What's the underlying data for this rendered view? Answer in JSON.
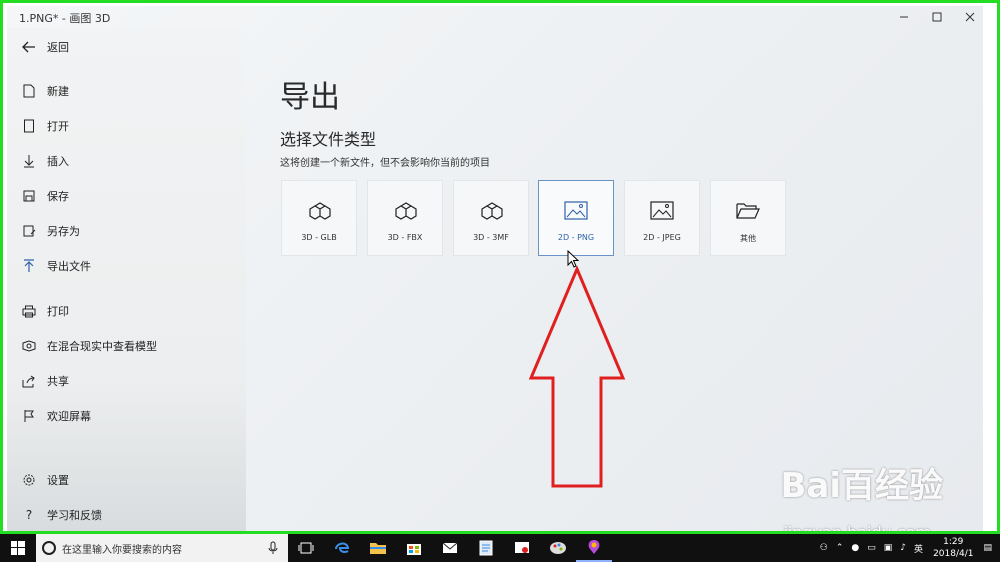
{
  "window": {
    "title": "1.PNG* - 画图 3D"
  },
  "sidebar": {
    "back_label": "返回",
    "items": [
      {
        "label": "新建",
        "icon": "new-file-icon"
      },
      {
        "label": "打开",
        "icon": "open-icon"
      },
      {
        "label": "插入",
        "icon": "insert-icon"
      },
      {
        "label": "保存",
        "icon": "save-icon"
      },
      {
        "label": "另存为",
        "icon": "save-as-icon"
      },
      {
        "label": "导出文件",
        "icon": "export-icon"
      },
      {
        "label": "打印",
        "icon": "print-icon"
      },
      {
        "label": "在混合现实中查看模型",
        "icon": "mixed-reality-icon"
      },
      {
        "label": "共享",
        "icon": "share-icon"
      },
      {
        "label": "欢迎屏幕",
        "icon": "flag-icon"
      }
    ],
    "bottom": [
      {
        "label": "设置",
        "icon": "gear-icon"
      },
      {
        "label": "学习和反馈",
        "icon": "help-icon"
      }
    ]
  },
  "main": {
    "heading": "导出",
    "subheading": "选择文件类型",
    "description": "这将创建一个新文件，但不会影响你当前的项目",
    "file_types": [
      {
        "label": "3D - GLB",
        "icon": "3d-shapes-icon"
      },
      {
        "label": "3D - FBX",
        "icon": "3d-shapes-icon"
      },
      {
        "label": "3D - 3MF",
        "icon": "3d-shapes-icon"
      },
      {
        "label": "2D - PNG",
        "icon": "image-icon",
        "selected": true
      },
      {
        "label": "2D - JPEG",
        "icon": "image-icon"
      },
      {
        "label": "其他",
        "icon": "folder-icon"
      }
    ]
  },
  "watermark": {
    "brand": "Bai百经验",
    "url": "jingyan.baidu.com"
  },
  "taskbar": {
    "search_placeholder": "在这里输入你要搜索的内容",
    "ime": "英",
    "time": "1:29",
    "date": "2018/4/1"
  },
  "colors": {
    "frame_border": "#22dd22",
    "annotation_arrow": "#e02020",
    "selected_tile_border": "#6b93c8"
  }
}
